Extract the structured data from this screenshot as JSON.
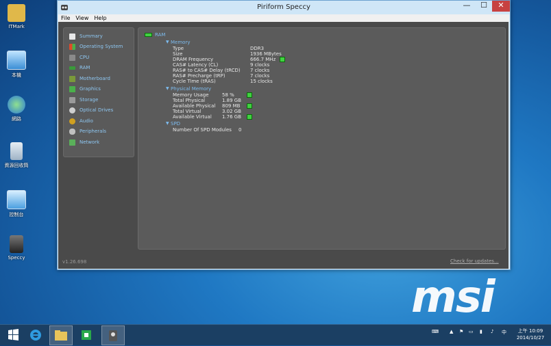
{
  "desktop": {
    "icons": [
      {
        "label": "ITMark"
      },
      {
        "label": "本機"
      },
      {
        "label": "網路"
      },
      {
        "label": "資源回收筒"
      },
      {
        "label": "控制台"
      },
      {
        "label": "Speccy"
      }
    ]
  },
  "window": {
    "title": "Piriform Speccy",
    "controls": {
      "minimize": "—",
      "maximize": "☐",
      "close": "✕"
    },
    "menu": [
      "File",
      "View",
      "Help"
    ]
  },
  "sidebar": {
    "items": [
      {
        "label": "Summary",
        "color": "#e8e8e8"
      },
      {
        "label": "Operating System",
        "color": "#2c8de0"
      },
      {
        "label": "CPU",
        "color": "#8a8a8a"
      },
      {
        "label": "RAM",
        "color": "#3a9a3a"
      },
      {
        "label": "Motherboard",
        "color": "#7a9a3a"
      },
      {
        "label": "Graphics",
        "color": "#4ab04a"
      },
      {
        "label": "Storage",
        "color": "#9a9a9a"
      },
      {
        "label": "Optical Drives",
        "color": "#cfcfcf"
      },
      {
        "label": "Audio",
        "color": "#d0a020"
      },
      {
        "label": "Peripherals",
        "color": "#c0c0c0"
      },
      {
        "label": "Network",
        "color": "#5ab05a"
      }
    ],
    "active": "RAM"
  },
  "ram": {
    "heading": "RAM",
    "memory": {
      "title": "Memory",
      "rows": [
        {
          "label": "Type",
          "value": "DDR3",
          "indicator": false
        },
        {
          "label": "Size",
          "value": "1936 MBytes",
          "indicator": false
        },
        {
          "label": "DRAM Frequency",
          "value": "666.7 MHz",
          "indicator": true
        },
        {
          "label": "CAS# Latency (CL)",
          "value": "9 clocks",
          "indicator": false
        },
        {
          "label": "RAS# to CAS# Delay (tRCD)",
          "value": "7 clocks",
          "indicator": false
        },
        {
          "label": "RAS# Precharge (tRP)",
          "value": "7 clocks",
          "indicator": false
        },
        {
          "label": "Cycle Time (tRAS)",
          "value": "15 clocks",
          "indicator": false
        }
      ]
    },
    "physical": {
      "title": "Physical Memory",
      "rows": [
        {
          "label": "Memory Usage",
          "value": "58 %",
          "indicator": true
        },
        {
          "label": "Total Physical",
          "value": "1.89 GB",
          "indicator": false
        },
        {
          "label": "Available Physical",
          "value": "809 MB",
          "indicator": true
        },
        {
          "label": "Total Virtual",
          "value": "3.02 GB",
          "indicator": false
        },
        {
          "label": "Available Virtual",
          "value": "1.76 GB",
          "indicator": true
        }
      ]
    },
    "spd": {
      "title": "SPD",
      "rows": [
        {
          "label": "Number Of SPD Modules",
          "value": "0"
        }
      ]
    }
  },
  "footer": {
    "version": "v1.26.698",
    "check_updates": "Check for updates..."
  },
  "taskbar": {
    "clock_time": "上午 10:09",
    "clock_date": "2014/10/27"
  },
  "wallpaper_logo": "msi"
}
